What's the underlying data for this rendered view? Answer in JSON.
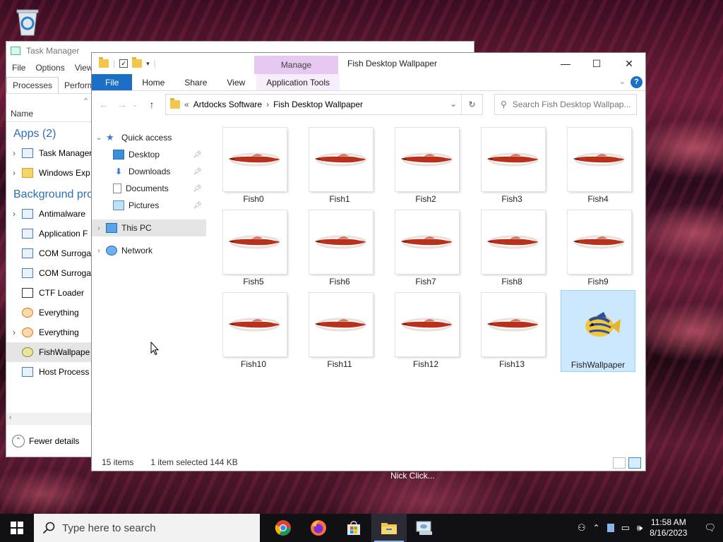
{
  "desktop": {
    "recycle_bin_icon": "recycle-bin-icon",
    "nick_click_text": "Nick Click..."
  },
  "task_manager": {
    "title": "Task Manager",
    "menu": [
      "File",
      "Options",
      "View"
    ],
    "tabs": [
      "Processes",
      "Performa"
    ],
    "column_name": "Name",
    "apps_header": "Apps (2)",
    "apps": [
      {
        "expand": "›",
        "label": "Task Manager"
      },
      {
        "expand": "›",
        "label": "Windows Exp"
      }
    ],
    "background_header": "Background proc",
    "background": [
      {
        "expand": "›",
        "label": "Antimalware"
      },
      {
        "expand": "",
        "label": "Application F"
      },
      {
        "expand": "",
        "label": "COM Surroga"
      },
      {
        "expand": "",
        "label": "COM Surroga"
      },
      {
        "expand": "",
        "label": "CTF Loader"
      },
      {
        "expand": "",
        "label": "Everything"
      },
      {
        "expand": "›",
        "label": "Everything"
      },
      {
        "expand": "",
        "label": "FishWallpape",
        "selected": true
      },
      {
        "expand": "",
        "label": "Host Process"
      }
    ],
    "fewer_details": "Fewer details"
  },
  "explorer": {
    "window_title": "Fish Desktop Wallpaper",
    "context_tab": "Manage",
    "ribbon_tabs": {
      "file": "File",
      "home": "Home",
      "share": "Share",
      "view": "View",
      "app_tools": "Application Tools"
    },
    "breadcrumb": {
      "overflow": "«",
      "part1": "Artdocks Software",
      "sep": "›",
      "part2": "Fish Desktop Wallpaper"
    },
    "search_placeholder": "Search Fish Desktop Wallpap...",
    "nav": {
      "quick_access": "Quick access",
      "desktop": "Desktop",
      "downloads": "Downloads",
      "documents": "Documents",
      "pictures": "Pictures",
      "this_pc": "This PC",
      "network": "Network"
    },
    "files": [
      "Fish0",
      "Fish1",
      "Fish2",
      "Fish3",
      "Fish4",
      "Fish5",
      "Fish6",
      "Fish7",
      "Fish8",
      "Fish9",
      "Fish10",
      "Fish11",
      "Fish12",
      "Fish13",
      "FishWallpaper"
    ],
    "selected_file": "FishWallpaper",
    "status": {
      "items": "15 items",
      "selection": "1 item selected  144 KB"
    }
  },
  "taskbar": {
    "search_placeholder": "Type here to search",
    "apps": [
      "chrome-icon",
      "firefox-icon",
      "store-icon",
      "file-explorer-icon",
      "fish-app-icon"
    ],
    "time": "11:58 AM",
    "date": "8/16/2023"
  }
}
